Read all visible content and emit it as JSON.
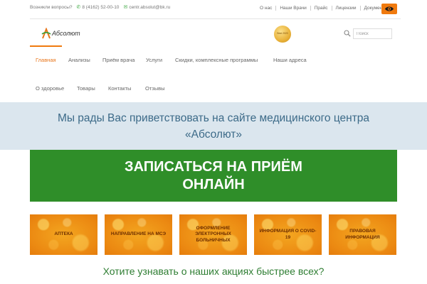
{
  "topbar": {
    "question": "Возникли вопросы?",
    "phone": "8 (4162) 52-00-10",
    "email": "centr.absolut@bk.ru",
    "links": [
      "О нас",
      "Наши Врачи",
      "Прайс",
      "Лицензии",
      "Документы"
    ]
  },
  "header": {
    "logo_text": "Абсолют",
    "medal_text": "Best 2020",
    "search_placeholder": "Поиск"
  },
  "nav": {
    "home": "Главная",
    "tests": "Анализы",
    "doctor": "Приём врача",
    "services": "Услуги",
    "discounts": "Скидки, комплексные программы",
    "addresses": "Наши адреса",
    "health": "О здоровье",
    "goods": "Товары",
    "contacts": "Контакты",
    "reviews": "Отзывы"
  },
  "welcome_text": "Мы рады Вас приветствовать на сайте медицинского центра «Абсолют»",
  "signup_banner": "ЗАПИСАТЬСЯ НА ПРИЁМ ОНЛАЙН",
  "tiles": [
    "Аптека",
    "Направление на МСЭ",
    "Оформление электронных больничных",
    "Информация о COVID-19",
    "Правовая информация"
  ],
  "promo_text": "Хотите узнавать о наших акциях быстрее всех?",
  "colors": {
    "accent_orange": "#f07a0e",
    "brand_green": "#2f8e29",
    "welcome_bg": "#dbe6ee",
    "welcome_text": "#3c6a88",
    "tile_orange": "#ec8a12"
  }
}
